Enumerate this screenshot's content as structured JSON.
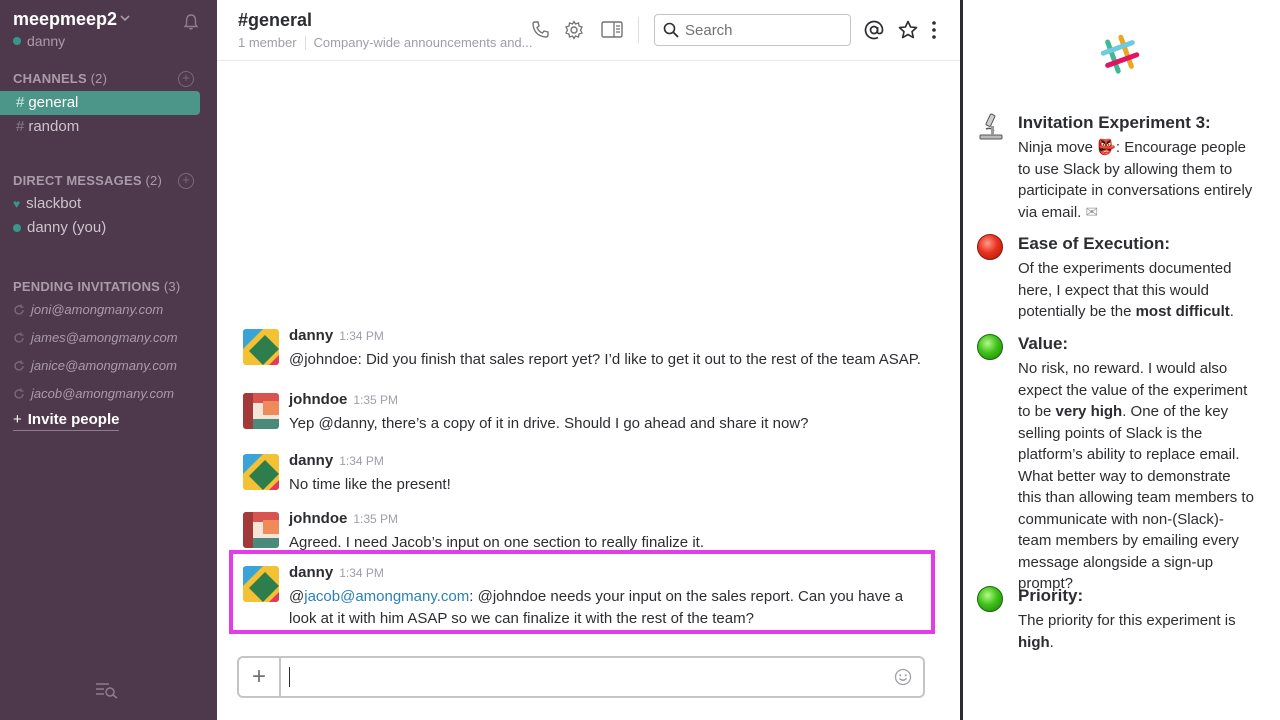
{
  "sidebar": {
    "team_name": "meepmeep2",
    "user": "danny",
    "channels_header": "CHANNELS",
    "channels_count": "(2)",
    "channels": [
      {
        "name": "general",
        "active": true
      },
      {
        "name": "random",
        "active": false
      }
    ],
    "dm_header": "DIRECT MESSAGES",
    "dm_count": "(2)",
    "dms": [
      {
        "name": "slackbot",
        "icon": "heart-icon"
      },
      {
        "name": "danny (you)",
        "icon": "presence-dot"
      }
    ],
    "pending_header": "PENDING INVITATIONS",
    "pending_count": "(3)",
    "pending": [
      "joni@amongmany.com",
      "james@amongmany.com",
      "janice@amongmany.com",
      "jacob@amongmany.com"
    ],
    "invite_label": "Invite people",
    "accent_color": "#4c9689"
  },
  "header": {
    "channel": "#general",
    "members": "1 member",
    "topic": "Company-wide announcements and...",
    "search_placeholder": "Search"
  },
  "messages": [
    {
      "author": "danny",
      "time": "1:34 PM",
      "avatar": "danny-avatar",
      "text": "@johndoe: Did you finish that sales report yet? I’d like to get it out to the rest of the team ASAP."
    },
    {
      "author": "johndoe",
      "time": "1:35 PM",
      "avatar": "johndoe-avatar",
      "text": "Yep @danny, there’s a copy of it in drive. Should I go ahead and share it now?"
    },
    {
      "author": "danny",
      "time": "1:34 PM",
      "avatar": "danny-avatar",
      "text": "No time like the present!"
    },
    {
      "author": "johndoe",
      "time": "1:35 PM",
      "avatar": "johndoe-avatar",
      "text": "Agreed. I need Jacob’s input on one section to really finalize it."
    },
    {
      "author": "danny",
      "time": "1:34 PM",
      "avatar": "danny-avatar",
      "prefix": "@",
      "link": "jacob@amongmany.com",
      "text": ": @johndoe needs your input on the sales report. Can you have a look at it with him ASAP so we can finalize it with the rest of the team?"
    }
  ],
  "highlight_color": "#e63ce8",
  "panel": {
    "items": [
      {
        "icon": "microscope-icon",
        "title": "Invitation Experiment 3:",
        "before": "Ninja move ",
        "emoji": "👺",
        "middle": ":  Encourage people to use Slack by allowing them to participate in conversations entirely via email. ",
        "end_emoji": "✉"
      },
      {
        "icon": "red-light-icon",
        "title": "Ease of Execution:",
        "before": "Of the experiments documented here, I expect that this would potentially be the ",
        "bold": "most difficult",
        "after": "."
      },
      {
        "icon": "green-light-icon",
        "title": "Value:",
        "before": "No risk, no reward. I would also expect the value of the experiment to be ",
        "bold": "very high",
        "after": ". One of the key selling points of Slack is the platform’s ability to replace email. What better way to demonstrate this than allowing team members to communicate with non-(Slack)-team members by emailing every message alongside a sign-up prompt?"
      },
      {
        "icon": "green-light-icon",
        "title": "Priority:",
        "before": "The priority for this experiment is ",
        "bold": "high",
        "after": "."
      }
    ]
  }
}
